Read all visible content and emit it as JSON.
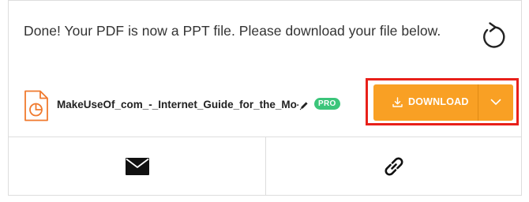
{
  "message": "Done! Your PDF is now a PPT file. Please download your file below.",
  "icons": {
    "restart": "restart-icon",
    "file": "ppt-file-icon",
    "edit": "pencil-icon",
    "download": "download-icon",
    "dropdown": "chevron-down-icon",
    "email": "envelope-icon",
    "link": "link-icon"
  },
  "file": {
    "name": "MakeUseOf_com_-_Internet_Guide_for_the_Mo-conve",
    "badge": "PRO"
  },
  "actions": {
    "download_label": "DOWNLOAD"
  },
  "colors": {
    "accent": "#f9a024",
    "badge": "#3bc57a",
    "highlight": "#e8201a",
    "file_icon": "#f07a2e"
  }
}
